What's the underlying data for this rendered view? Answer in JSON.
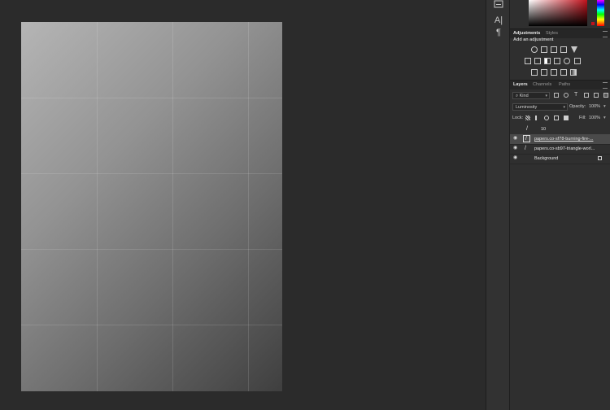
{
  "tool_icons": {
    "top": "navigator-icon",
    "character": "character-panel-icon",
    "paragraph": "paragraph-icon"
  },
  "toolstrip_glyphs": {
    "character": "A|",
    "paragraph": "¶"
  },
  "adjustments_panel": {
    "tabs": [
      "Adjustments",
      "Styles"
    ],
    "caption": "Add an adjustment",
    "icons": [
      "brightness-contrast-icon",
      "levels-icon",
      "curves-icon",
      "exposure-icon",
      "vibrance-icon",
      "hue-saturation-icon",
      "color-balance-icon",
      "black-white-icon",
      "photo-filter-icon",
      "channel-mixer-icon",
      "color-lookup-icon",
      "invert-icon",
      "posterize-icon",
      "threshold-icon",
      "selective-color-icon",
      "gradient-map-icon"
    ]
  },
  "layers_panel": {
    "tabs": [
      "Layers",
      "Channels",
      "Paths"
    ],
    "filter_kind": "Kind",
    "filter_glyph": "⌕",
    "blend_mode": "Luminosity",
    "opacity_label": "Opacity:",
    "opacity_value": "100%",
    "lock_label": "Lock:",
    "fill_label": "Fill:",
    "fill_value": "100%",
    "layers": [
      {
        "name": "10",
        "visible": false,
        "selected": false,
        "glyph": "/"
      },
      {
        "name": "papers.co-sf78-burning-fire-...",
        "visible": true,
        "selected": true,
        "glyph": "/"
      },
      {
        "name": "papers.co-sb97-triangle-worl...",
        "visible": true,
        "selected": false,
        "glyph": "/"
      },
      {
        "name": "Background",
        "visible": true,
        "selected": false,
        "glyph": "",
        "locked": true
      }
    ]
  },
  "colors": {
    "workspace_bg": "#2b2b2b",
    "panel_bg": "#2f2f2f",
    "selected_row": "#4a4a4a"
  }
}
